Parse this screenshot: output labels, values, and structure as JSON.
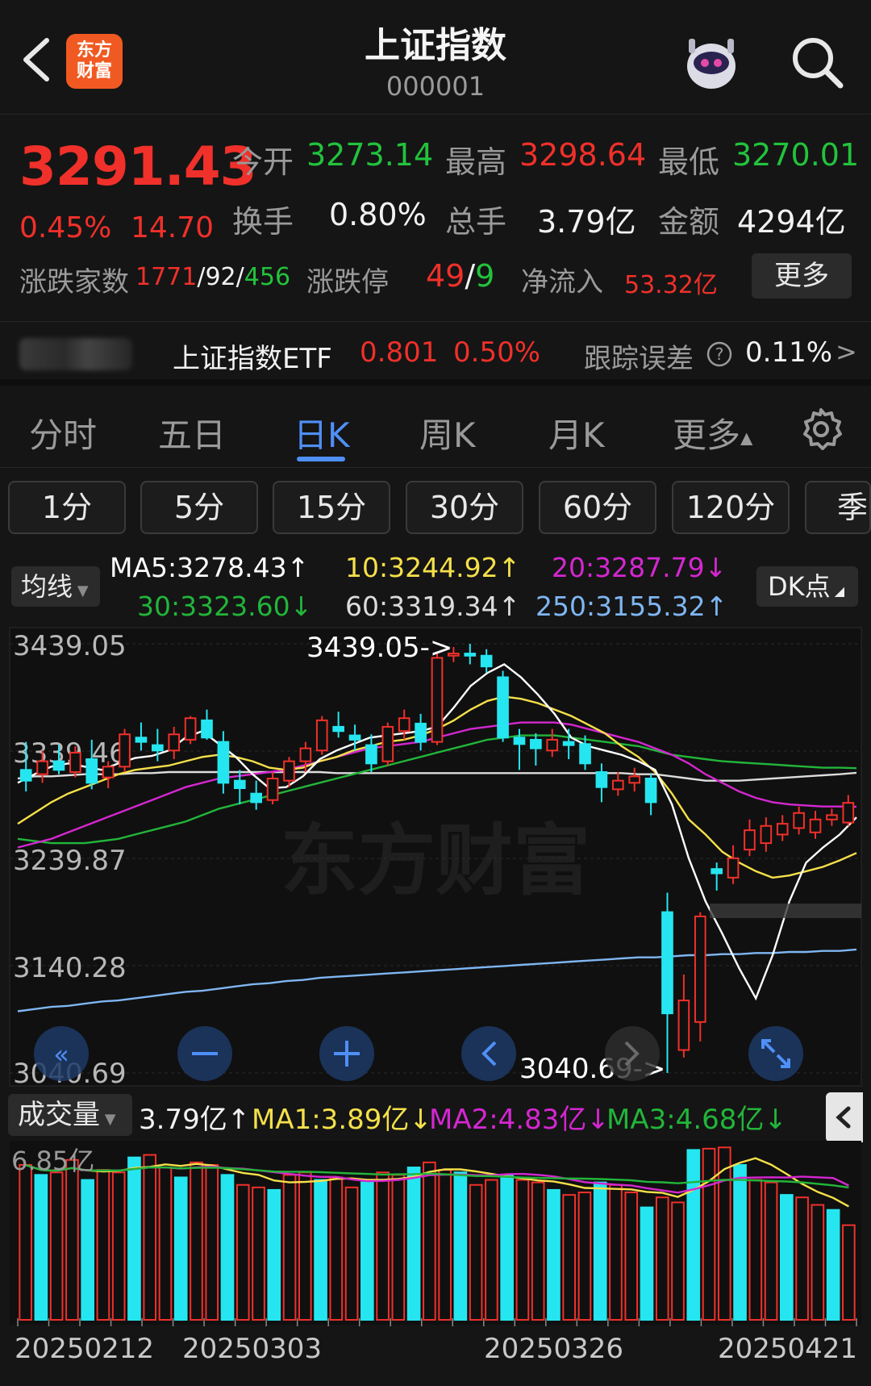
{
  "header": {
    "title": "上证指数",
    "code": "000001",
    "logo_text": "东方财富"
  },
  "quote": {
    "last": "3291.43",
    "change_pct": "0.45%",
    "change_amt": "14.70",
    "open_label": "今开",
    "open": "3273.14",
    "high_label": "最高",
    "high": "3298.64",
    "low_label": "最低",
    "low": "3270.01",
    "turnover_label": "换手",
    "turnover": "0.80%",
    "volume_label": "总手",
    "volume": "3.79亿",
    "amount_label": "金额",
    "amount": "4294亿",
    "breadth_label": "涨跌家数",
    "up": "1771",
    "flat": "92",
    "down": "456",
    "limit_label": "涨跌停",
    "limit_up": "49",
    "limit_down": "9",
    "inflow_label": "净流入",
    "inflow": "53.32亿",
    "more_label": "更多"
  },
  "etf": {
    "name": "上证指数ETF",
    "price": "0.801",
    "change": "0.50%",
    "tracking_label": "跟踪误差",
    "tracking_value": "0.11%",
    "arrow": ">"
  },
  "tabs": [
    {
      "label": "分时"
    },
    {
      "label": "五日"
    },
    {
      "label": "日K"
    },
    {
      "label": "周K"
    },
    {
      "label": "月K"
    },
    {
      "label": "更多"
    }
  ],
  "intervals": [
    {
      "label": "1分"
    },
    {
      "label": "5分"
    },
    {
      "label": "15分"
    },
    {
      "label": "30分"
    },
    {
      "label": "60分"
    },
    {
      "label": "120分"
    },
    {
      "label": "季"
    }
  ],
  "ma_legend": {
    "select_label": "均线",
    "ma5": "MA5:3278.43↑",
    "ma10": "10:3244.92↑",
    "ma20": "20:3287.79↓",
    "ma30": "30:3323.60↓",
    "ma60": "60:3319.34↑",
    "ma250": "250:3155.32↑",
    "dk_label": "DK点"
  },
  "volume_legend": {
    "select_label": "成交量",
    "current": "3.79亿↑",
    "ma1": "MA1:3.89亿↓",
    "ma2": "MA2:4.83亿↓",
    "ma3": "MA3:4.68亿↓"
  },
  "colors": {
    "up": "#f0302a",
    "down": "#25e6f0",
    "ma5": "#ffffff",
    "ma10": "#f5e04a",
    "ma20": "#d427d0",
    "ma30": "#22b53a",
    "ma60": "#dcdcdc",
    "ma250": "#7fb6f2"
  },
  "chart_data": {
    "type": "candlestick",
    "y_ticks": [
      "3439.05",
      "3339.46",
      "3239.87",
      "3140.28",
      "3040.69"
    ],
    "ylim": [
      3040.69,
      3439.05
    ],
    "max_marker": "3439.05->",
    "min_marker": "3040.69->",
    "watermark": "东方财富",
    "dates": [
      "20250212",
      "20250303",
      "20250326",
      "20250421"
    ],
    "candles": [
      {
        "o": 3322,
        "h": 3348,
        "l": 3302,
        "c": 3312
      },
      {
        "o": 3318,
        "h": 3340,
        "l": 3310,
        "c": 3330
      },
      {
        "o": 3330,
        "h": 3345,
        "l": 3318,
        "c": 3322
      },
      {
        "o": 3320,
        "h": 3344,
        "l": 3315,
        "c": 3338
      },
      {
        "o": 3332,
        "h": 3350,
        "l": 3304,
        "c": 3310
      },
      {
        "o": 3315,
        "h": 3330,
        "l": 3305,
        "c": 3325
      },
      {
        "o": 3325,
        "h": 3360,
        "l": 3320,
        "c": 3355
      },
      {
        "o": 3352,
        "h": 3366,
        "l": 3340,
        "c": 3348
      },
      {
        "o": 3345,
        "h": 3360,
        "l": 3330,
        "c": 3340
      },
      {
        "o": 3340,
        "h": 3362,
        "l": 3332,
        "c": 3355
      },
      {
        "o": 3350,
        "h": 3372,
        "l": 3346,
        "c": 3370
      },
      {
        "o": 3368,
        "h": 3378,
        "l": 3350,
        "c": 3352
      },
      {
        "o": 3348,
        "h": 3358,
        "l": 3300,
        "c": 3310
      },
      {
        "o": 3312,
        "h": 3322,
        "l": 3290,
        "c": 3305
      },
      {
        "o": 3300,
        "h": 3312,
        "l": 3285,
        "c": 3292
      },
      {
        "o": 3294,
        "h": 3320,
        "l": 3290,
        "c": 3314
      },
      {
        "o": 3312,
        "h": 3334,
        "l": 3306,
        "c": 3330
      },
      {
        "o": 3330,
        "h": 3348,
        "l": 3320,
        "c": 3342
      },
      {
        "o": 3340,
        "h": 3372,
        "l": 3336,
        "c": 3368
      },
      {
        "o": 3362,
        "h": 3376,
        "l": 3352,
        "c": 3358
      },
      {
        "o": 3354,
        "h": 3364,
        "l": 3340,
        "c": 3350
      },
      {
        "o": 3345,
        "h": 3355,
        "l": 3320,
        "c": 3328
      },
      {
        "o": 3330,
        "h": 3366,
        "l": 3326,
        "c": 3362
      },
      {
        "o": 3358,
        "h": 3378,
        "l": 3350,
        "c": 3370
      },
      {
        "o": 3365,
        "h": 3374,
        "l": 3340,
        "c": 3348
      },
      {
        "o": 3348,
        "h": 3430,
        "l": 3345,
        "c": 3426
      },
      {
        "o": 3428,
        "h": 3436,
        "l": 3422,
        "c": 3430
      },
      {
        "o": 3430,
        "h": 3439.05,
        "l": 3420,
        "c": 3428
      },
      {
        "o": 3428,
        "h": 3434,
        "l": 3412,
        "c": 3418
      },
      {
        "o": 3408,
        "h": 3414,
        "l": 3348,
        "c": 3352
      },
      {
        "o": 3352,
        "h": 3360,
        "l": 3322,
        "c": 3346
      },
      {
        "o": 3350,
        "h": 3356,
        "l": 3326,
        "c": 3342
      },
      {
        "o": 3340,
        "h": 3360,
        "l": 3334,
        "c": 3350
      },
      {
        "o": 3348,
        "h": 3360,
        "l": 3332,
        "c": 3345
      },
      {
        "o": 3346,
        "h": 3354,
        "l": 3322,
        "c": 3328
      },
      {
        "o": 3320,
        "h": 3328,
        "l": 3292,
        "c": 3306
      },
      {
        "o": 3304,
        "h": 3320,
        "l": 3298,
        "c": 3312
      },
      {
        "o": 3310,
        "h": 3324,
        "l": 3302,
        "c": 3316
      },
      {
        "o": 3314,
        "h": 3318,
        "l": 3280,
        "c": 3292
      },
      {
        "o": 3190,
        "h": 3208,
        "l": 3040.69,
        "c": 3096
      },
      {
        "o": 3062,
        "h": 3132,
        "l": 3055,
        "c": 3108
      },
      {
        "o": 3088,
        "h": 3190,
        "l": 3070,
        "c": 3186
      },
      {
        "o": 3230,
        "h": 3236,
        "l": 3210,
        "c": 3226
      },
      {
        "o": 3222,
        "h": 3252,
        "l": 3216,
        "c": 3240
      },
      {
        "o": 3248,
        "h": 3276,
        "l": 3242,
        "c": 3266
      },
      {
        "o": 3254,
        "h": 3278,
        "l": 3246,
        "c": 3270
      },
      {
        "o": 3262,
        "h": 3280,
        "l": 3256,
        "c": 3272
      },
      {
        "o": 3268,
        "h": 3288,
        "l": 3262,
        "c": 3282
      },
      {
        "o": 3264,
        "h": 3284,
        "l": 3258,
        "c": 3276
      },
      {
        "o": 3276,
        "h": 3286,
        "l": 3270,
        "c": 3280
      },
      {
        "o": 3273.14,
        "h": 3298.64,
        "l": 3270.01,
        "c": 3291.43
      }
    ],
    "ma_lines": {
      "ma5": [
        3310,
        3318,
        3325,
        3328,
        3325,
        3322,
        3328,
        3333,
        3335,
        3340,
        3352,
        3358,
        3346,
        3334,
        3318,
        3305,
        3306,
        3316,
        3332,
        3340,
        3346,
        3352,
        3354,
        3356,
        3358,
        3362,
        3380,
        3400,
        3412,
        3420,
        3408,
        3392,
        3374,
        3352,
        3344,
        3340,
        3336,
        3330,
        3322,
        3290,
        3240,
        3200,
        3170,
        3138,
        3110,
        3150,
        3200,
        3236,
        3250,
        3262,
        3278
      ],
      "ma10": [
        3272,
        3282,
        3292,
        3300,
        3306,
        3312,
        3318,
        3322,
        3324,
        3326,
        3330,
        3334,
        3336,
        3334,
        3330,
        3324,
        3322,
        3324,
        3330,
        3334,
        3340,
        3344,
        3348,
        3350,
        3354,
        3360,
        3368,
        3378,
        3386,
        3390,
        3388,
        3384,
        3378,
        3372,
        3364,
        3356,
        3344,
        3334,
        3320,
        3300,
        3276,
        3262,
        3246,
        3236,
        3228,
        3222,
        3224,
        3228,
        3232,
        3238,
        3244.92
      ],
      "ma20": [
        3250,
        3254,
        3258,
        3264,
        3270,
        3276,
        3282,
        3288,
        3294,
        3300,
        3306,
        3310,
        3314,
        3316,
        3318,
        3320,
        3322,
        3326,
        3330,
        3334,
        3338,
        3342,
        3344,
        3346,
        3348,
        3352,
        3356,
        3360,
        3362,
        3364,
        3366,
        3366,
        3366,
        3364,
        3360,
        3356,
        3352,
        3348,
        3342,
        3336,
        3328,
        3318,
        3310,
        3302,
        3296,
        3292,
        3290,
        3289,
        3288,
        3288,
        3287.79
      ],
      "ma30": [
        3258,
        3256,
        3254,
        3254,
        3254,
        3256,
        3258,
        3262,
        3266,
        3270,
        3274,
        3280,
        3286,
        3290,
        3294,
        3298,
        3302,
        3306,
        3310,
        3314,
        3318,
        3322,
        3326,
        3330,
        3334,
        3338,
        3342,
        3346,
        3350,
        3352,
        3354,
        3354,
        3354,
        3352,
        3350,
        3348,
        3346,
        3344,
        3340,
        3336,
        3334,
        3332,
        3330,
        3329,
        3328,
        3327,
        3326,
        3325,
        3324,
        3324,
        3323.6
      ],
      "ma60": [
        3314,
        3316,
        3316,
        3317,
        3318,
        3318,
        3318,
        3319,
        3319,
        3320,
        3320,
        3320,
        3320,
        3320,
        3320,
        3320,
        3320,
        3320,
        3320,
        3319,
        3319,
        3319,
        3319,
        3319,
        3319,
        3319,
        3319,
        3319,
        3319,
        3319,
        3319,
        3319,
        3319,
        3319,
        3319,
        3319,
        3319,
        3318,
        3318,
        3316,
        3314,
        3312,
        3312,
        3312,
        3313,
        3314,
        3315,
        3316,
        3317,
        3318,
        3319.34
      ],
      "ma250": [
        3098,
        3100,
        3102,
        3103,
        3105,
        3107,
        3108,
        3110,
        3112,
        3114,
        3116,
        3117,
        3119,
        3121,
        3123,
        3124,
        3126,
        3127,
        3129,
        3130,
        3131,
        3132,
        3133,
        3134,
        3135,
        3136,
        3137,
        3138,
        3139,
        3140,
        3141,
        3142,
        3143,
        3144,
        3145,
        3146,
        3147,
        3148,
        3148,
        3149,
        3150,
        3150,
        3151,
        3151,
        3152,
        3152,
        3153,
        3153,
        3154,
        3154,
        3155.32
      ]
    },
    "volume": {
      "ymax_label": "6.85亿",
      "ymax": 6.85,
      "bars": [
        6.2,
        5.8,
        5.9,
        6.4,
        5.6,
        6.0,
        5.9,
        6.5,
        6.6,
        6.1,
        5.7,
        6.3,
        6.2,
        5.8,
        5.4,
        5.3,
        5.2,
        5.8,
        5.9,
        5.6,
        5.7,
        5.3,
        5.5,
        5.9,
        5.8,
        6.1,
        6.3,
        6.0,
        5.9,
        5.4,
        5.6,
        5.8,
        5.6,
        5.5,
        5.2,
        5.0,
        5.1,
        5.5,
        5.4,
        5.1,
        4.5,
        4.9,
        4.7,
        6.8,
        6.85,
        6.9,
        6.2,
        5.6,
        5.5,
        5.0,
        4.9,
        4.6,
        4.4,
        3.79
      ]
    }
  }
}
